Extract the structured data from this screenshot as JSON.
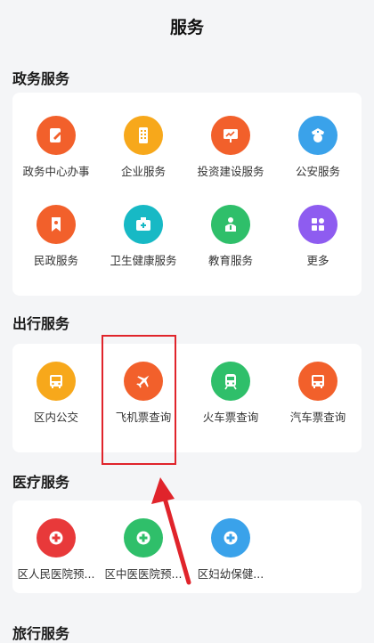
{
  "header": {
    "title": "服务"
  },
  "sections": [
    {
      "title": "政务服务",
      "items": [
        {
          "label": "政务中心办事",
          "icon": "edit-document-icon",
          "color": "#f2602b"
        },
        {
          "label": "企业服务",
          "icon": "building-icon",
          "color": "#f7a81b"
        },
        {
          "label": "投资建设服务",
          "icon": "chart-board-icon",
          "color": "#f2602b"
        },
        {
          "label": "公安服务",
          "icon": "police-icon",
          "color": "#3aa2ea"
        },
        {
          "label": "民政服务",
          "icon": "bookmark-icon",
          "color": "#f2602b"
        },
        {
          "label": "卫生健康服务",
          "icon": "medical-kit-icon",
          "color": "#17b9c5"
        },
        {
          "label": "教育服务",
          "icon": "teacher-icon",
          "color": "#2fbf6a"
        },
        {
          "label": "更多",
          "icon": "more-grid-icon",
          "color": "#8e5cf0"
        }
      ]
    },
    {
      "title": "出行服务",
      "items": [
        {
          "label": "区内公交",
          "icon": "bus-icon",
          "color": "#f7a81b"
        },
        {
          "label": "飞机票查询",
          "icon": "airplane-icon",
          "color": "#f2602b"
        },
        {
          "label": "火车票查询",
          "icon": "train-icon",
          "color": "#2fbf6a"
        },
        {
          "label": "汽车票查询",
          "icon": "coach-icon",
          "color": "#f2602b"
        }
      ]
    },
    {
      "title": "医疗服务",
      "items": [
        {
          "label": "区人民医院预...",
          "icon": "hospital-cross-icon",
          "color": "#e8393a"
        },
        {
          "label": "区中医医院预...",
          "icon": "hospital-cross-icon",
          "color": "#2fbf6a"
        },
        {
          "label": "区妇幼保健...",
          "icon": "hospital-cross-icon",
          "color": "#3aa2ea"
        }
      ]
    },
    {
      "title": "旅行服务",
      "items": []
    }
  ]
}
